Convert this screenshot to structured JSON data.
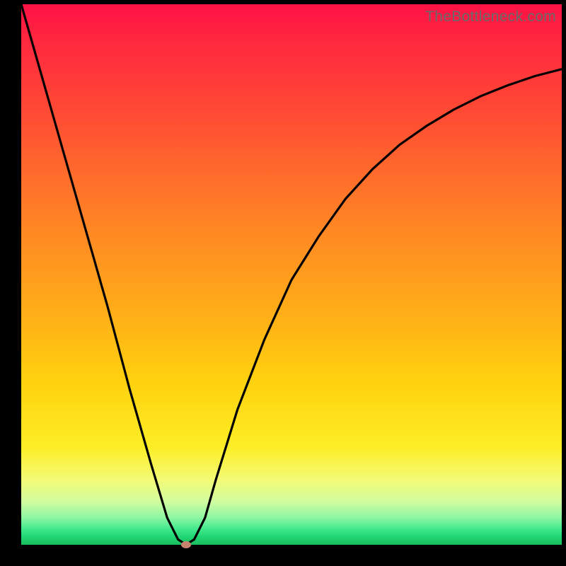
{
  "watermark": "TheBottleneck.com",
  "colors": {
    "frame_border": "#000000",
    "curve_stroke": "#000000",
    "marker_fill": "#c7836f",
    "gradient_top": "#ff1245",
    "gradient_bottom": "#1cbc5f"
  },
  "chart_data": {
    "type": "line",
    "title": "",
    "xlabel": "",
    "ylabel": "",
    "xlim": [
      0,
      100
    ],
    "ylim": [
      0,
      100
    ],
    "series": [
      {
        "name": "bottleneck-curve",
        "x": [
          0,
          4,
          8,
          12,
          16,
          20,
          24,
          27,
          29,
          30.5,
          32,
          34,
          36,
          40,
          45,
          50,
          55,
          60,
          65,
          70,
          75,
          80,
          85,
          90,
          95,
          100
        ],
        "y": [
          100,
          86,
          72,
          58,
          44,
          29,
          15,
          5,
          1,
          0,
          1,
          5,
          12,
          25,
          38,
          49,
          57,
          64,
          69.5,
          74,
          77.5,
          80.5,
          83,
          85,
          86.7,
          88
        ]
      }
    ],
    "marker": {
      "x": 30.5,
      "y": 0,
      "name": "minimum-point"
    }
  }
}
